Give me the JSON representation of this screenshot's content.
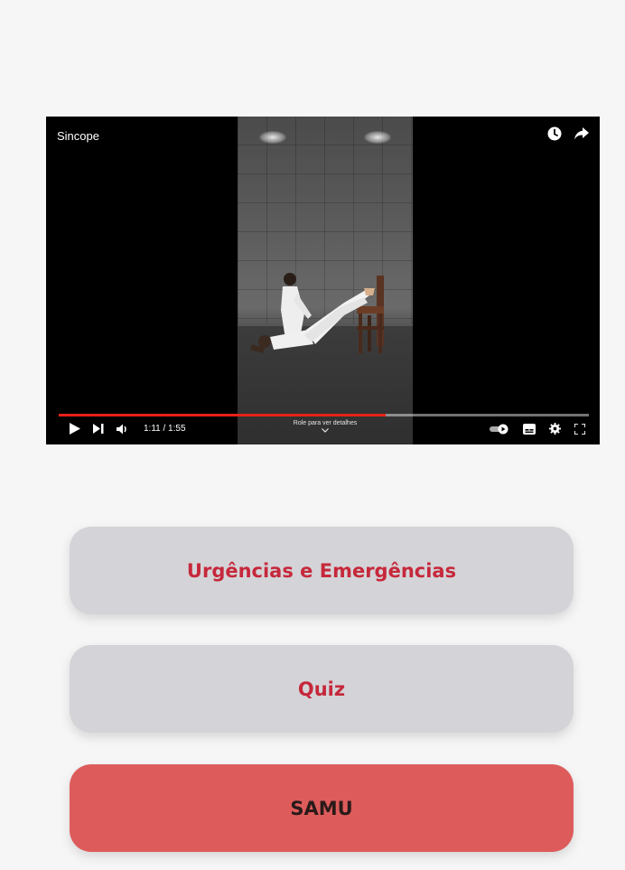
{
  "video": {
    "title": "Sincope",
    "time": "1:11 / 1:55",
    "progress": 0.617,
    "scroll_hint": "Role para ver detalhes"
  },
  "icons": {
    "watch_later": "clock-icon",
    "share": "share-arrow-icon",
    "play": "play-icon",
    "next": "skip-next-icon",
    "volume": "volume-icon",
    "autoplay": "autoplay-toggle-icon",
    "captions": "subtitles-icon",
    "settings": "gear-icon",
    "fullscreen": "fullscreen-icon",
    "chevron": "chevron-down-icon"
  },
  "colors": {
    "progress": "#e62117",
    "button_gray": "#d4d4d8",
    "button_red": "#dd5c5b",
    "label_red": "#c6283b"
  },
  "menu": {
    "urgencias_label": "Urgências e Emergências",
    "quiz_label": "Quiz",
    "samu_label": "SAMU"
  }
}
